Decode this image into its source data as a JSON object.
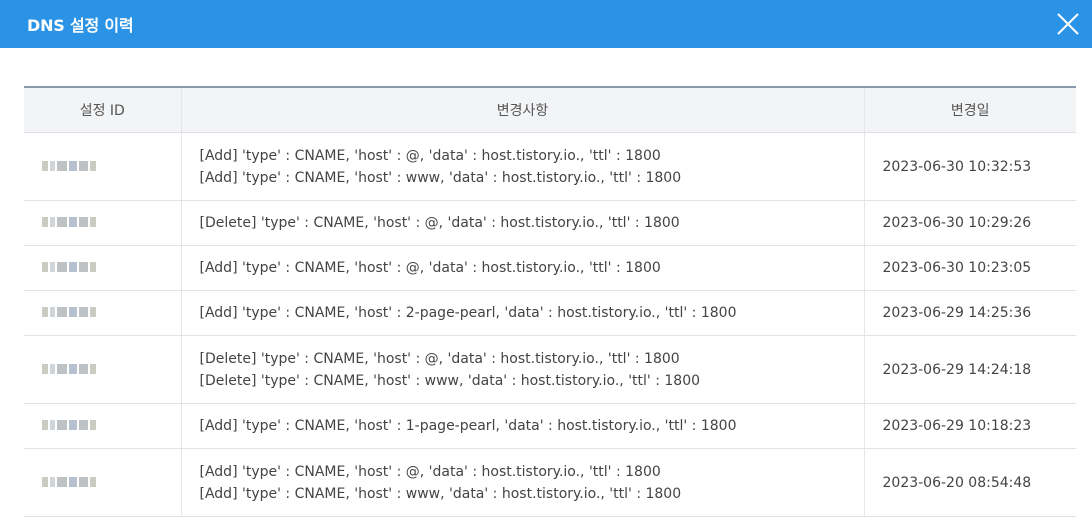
{
  "header": {
    "title": "DNS 설정 이력"
  },
  "table": {
    "columns": [
      "설정 ID",
      "변경사항",
      "변경일"
    ],
    "rows": [
      {
        "changes": [
          "[Add] 'type' : CNAME, 'host' : @, 'data' : host.tistory.io., 'ttl' : 1800",
          "[Add] 'type' : CNAME, 'host' : www, 'data' : host.tistory.io., 'ttl' : 1800"
        ],
        "date": "2023-06-30 10:32:53"
      },
      {
        "changes": [
          "[Delete] 'type' : CNAME, 'host' : @, 'data' : host.tistory.io., 'ttl' : 1800"
        ],
        "date": "2023-06-30 10:29:26"
      },
      {
        "changes": [
          "[Add] 'type' : CNAME, 'host' : @, 'data' : host.tistory.io., 'ttl' : 1800"
        ],
        "date": "2023-06-30 10:23:05"
      },
      {
        "changes": [
          "[Add] 'type' : CNAME, 'host' : 2-page-pearl, 'data' : host.tistory.io., 'ttl' : 1800"
        ],
        "date": "2023-06-29 14:25:36"
      },
      {
        "changes": [
          "[Delete] 'type' : CNAME, 'host' : @, 'data' : host.tistory.io., 'ttl' : 1800",
          "[Delete] 'type' : CNAME, 'host' : www, 'data' : host.tistory.io., 'ttl' : 1800"
        ],
        "date": "2023-06-29 14:24:18"
      },
      {
        "changes": [
          "[Add] 'type' : CNAME, 'host' : 1-page-pearl, 'data' : host.tistory.io., 'ttl' : 1800"
        ],
        "date": "2023-06-29 10:18:23"
      },
      {
        "changes": [
          "[Add] 'type' : CNAME, 'host' : @, 'data' : host.tistory.io., 'ttl' : 1800",
          "[Add] 'type' : CNAME, 'host' : www, 'data' : host.tistory.io., 'ttl' : 1800"
        ],
        "date": "2023-06-20 08:54:48"
      }
    ]
  },
  "colors": {
    "header": "#2a93e5",
    "header_text": "#ffffff"
  },
  "icons": {
    "close": "close-icon",
    "redacted_id": "blurred-id"
  }
}
